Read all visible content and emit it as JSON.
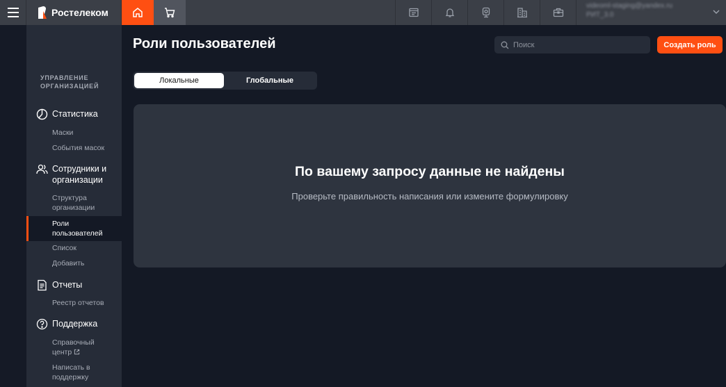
{
  "header": {
    "brand": "Ростелеком",
    "user_email": "videoml-staging@yandex.ru",
    "user_sub": "РИТ_3.0"
  },
  "sidebar": {
    "section_title": "УПРАВЛЕНИЕ ОРГАНИЗАЦИЕЙ",
    "groups": [
      {
        "label": "Статистика",
        "icon": "chart-pie-icon",
        "items": [
          "Маски",
          "События масок"
        ]
      },
      {
        "label": "Сотрудники и организации",
        "icon": "users-icon",
        "items": [
          "Структура организации",
          "Роли пользователей",
          "Список",
          "Добавить"
        ]
      },
      {
        "label": "Отчеты",
        "icon": "document-icon",
        "items": [
          "Реестр отчетов"
        ]
      },
      {
        "label": "Поддержка",
        "icon": "question-icon",
        "items": [
          "Справочный центр",
          "Написать в поддержку"
        ]
      }
    ],
    "active_item": "Роли пользователей"
  },
  "main": {
    "title": "Роли пользователей",
    "search_placeholder": "Поиск",
    "create_button": "Создать роль",
    "tabs": [
      {
        "label": "Локальные",
        "active": true
      },
      {
        "label": "Глобальные",
        "active": false
      }
    ],
    "empty_title": "По вашему запросу данные не найдены",
    "empty_subtitle": "Проверьте правильность написания или измените формулировку"
  },
  "colors": {
    "accent": "#ff4f12",
    "background": "#141925",
    "sidebar": "#262c38",
    "topbar": "#3b3f47",
    "card": "#2e343f"
  }
}
